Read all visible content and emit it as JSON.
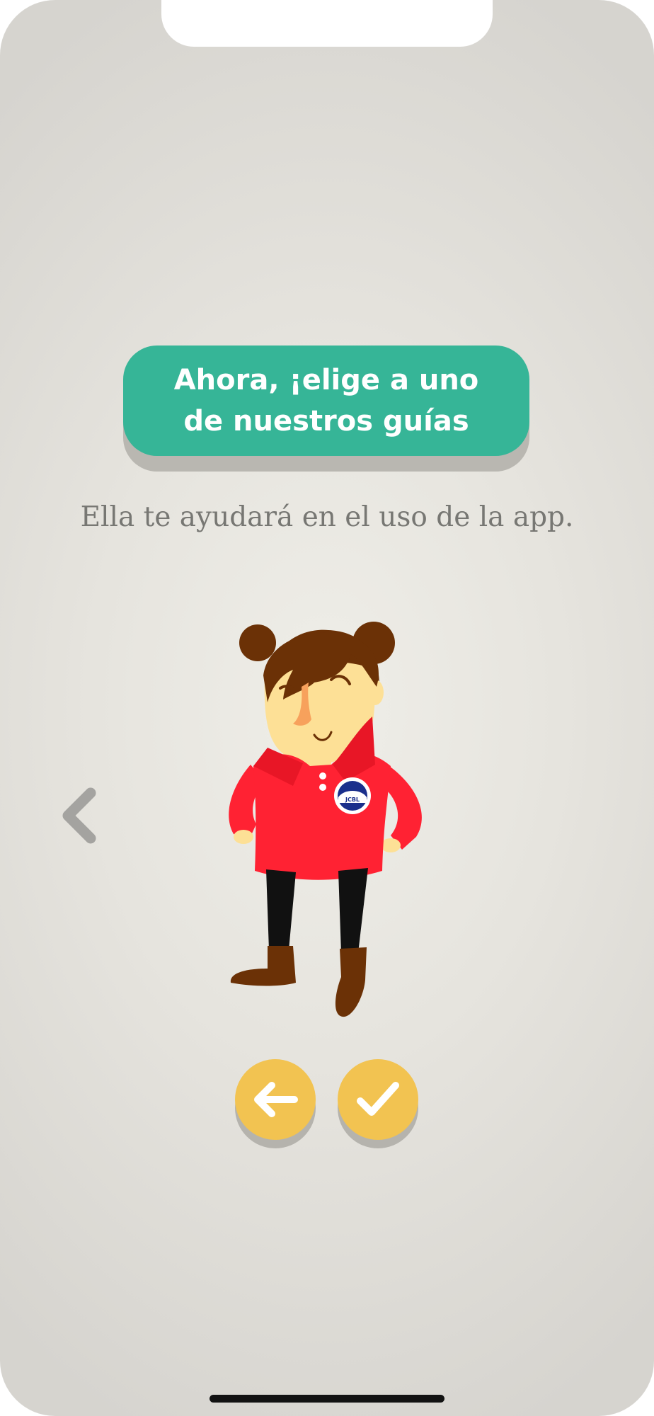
{
  "onboarding": {
    "title": "Ahora, ¡elige a uno de nuestros guías",
    "subtitle": "Ella te ayudará en el uso de la app.",
    "guide_badge_text": "JCBL"
  },
  "icons": {
    "previous": "chevron-left-icon",
    "back": "arrow-left-icon",
    "confirm": "checkmark-icon"
  },
  "colors": {
    "title_bg": "#36b597",
    "button_bg": "#f2c351",
    "shirt": "#ff2233",
    "hair": "#6b3106"
  }
}
